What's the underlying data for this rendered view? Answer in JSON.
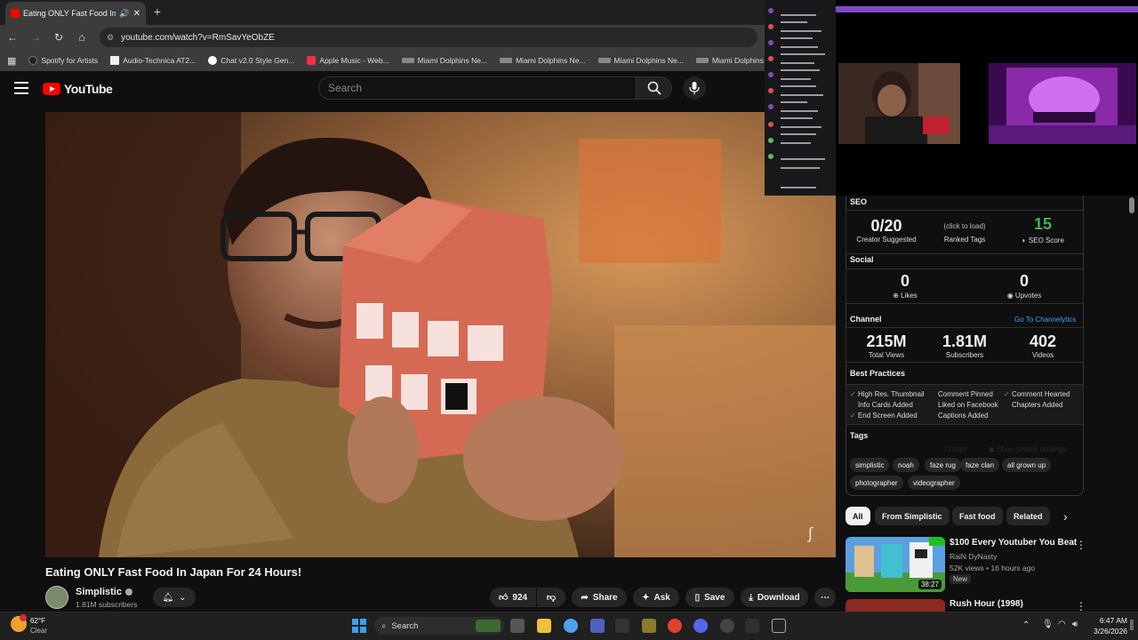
{
  "browser": {
    "tab_title": "Eating ONLY Fast Food In Ja",
    "new_tab_label": "+",
    "url": "youtube.com/watch?v=RmSavYeObZE",
    "bookmarks": [
      "Spotify for Artists",
      "Audio-Technica AT2...",
      "Chat v2.0 Style Gen...",
      "Apple Music - Web...",
      "Miami Dolphins Ne...",
      "Miami Dolphins Ne...",
      "Miami Dolphins Ne...",
      "Miami Dolphins Ne..."
    ]
  },
  "youtube": {
    "logo": "YouTube",
    "search_placeholder": "Search",
    "video_title": "Eating ONLY Fast Food In Japan For 24 Hours!",
    "channel_name": "Simplistic",
    "channel_subs": "1.81M subscribers",
    "likes": "924",
    "share": "Share",
    "ask": "Ask",
    "save": "Save",
    "download": "Download"
  },
  "vidiq": {
    "seo_title": "SEO",
    "creator_suggested_value": "0/20",
    "creator_suggested_label": "Creator Suggested",
    "ranked_tags_value": "(click to load)",
    "ranked_tags_label": "Ranked Tags",
    "seo_score_value": "15",
    "seo_score_label": "SEO Score",
    "social_title": "Social",
    "likes_value": "0",
    "likes_label": "Likes",
    "upvotes_value": "0",
    "upvotes_label": "Upvotes",
    "channel_title": "Channel",
    "channel_link": "Go To Channelytics",
    "total_views_value": "215M",
    "total_views_label": "Total Views",
    "subscribers_value": "1.81M",
    "subscribers_label": "Subscribers",
    "videos_value": "402",
    "videos_label": "Videos",
    "best_practices_title": "Best Practices",
    "best_practices": [
      "High Res. Thumbnail",
      "Comment Pinned",
      "Comment Hearted",
      "Info Cards Added",
      "Liked on Facebook",
      "Chapters Added",
      "End Screen Added",
      "Captions Added"
    ],
    "tags_title": "Tags",
    "copy_label": "copy",
    "show_rankings_label": "Show search rankings",
    "tags": [
      "simplistic",
      "noah",
      "faze rug",
      "faze clan",
      "all grown up",
      "photographer",
      "videographer"
    ]
  },
  "chips": [
    "All",
    "From Simplistic",
    "Fast food",
    "Related"
  ],
  "recommendations": [
    {
      "title": "$100 Every Youtuber You Beat",
      "channel": "RaiN DyNasty",
      "meta": "52K views • 16 hours ago",
      "badge": "New",
      "duration": "38:27"
    },
    {
      "title": "Rush Hour (1998)"
    }
  ],
  "taskbar": {
    "temp": "62°F",
    "weather": "Clear",
    "search": "Search",
    "time": "6:47 AM",
    "date": "3/26/2026"
  },
  "colors": {
    "youtube_red": "#ff0000",
    "seo_score_green": "#4caf50",
    "twitch_purple": "#7d4ac8",
    "link_blue": "#3ea6ff"
  }
}
